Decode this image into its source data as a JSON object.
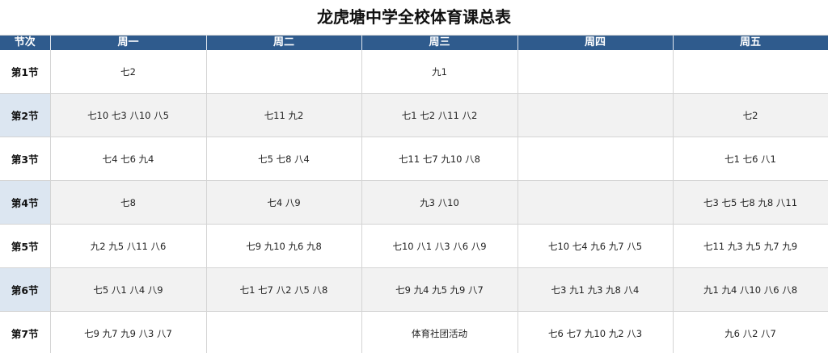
{
  "title": "龙虎塘中学全校体育课总表",
  "headers": [
    "节次",
    "周一",
    "周二",
    "周三",
    "周四",
    "周五"
  ],
  "rows": [
    {
      "period": "第1节",
      "cells": [
        "七2",
        "",
        "九1",
        "",
        ""
      ]
    },
    {
      "period": "第2节",
      "cells": [
        "七10 七3 八10 八5",
        "七11 九2",
        "七1 七2 八11 八2",
        "",
        "七2"
      ]
    },
    {
      "period": "第3节",
      "cells": [
        "七4 七6 九4",
        "七5 七8 八4",
        "七11 七7 九10 八8",
        "",
        "七1 七6 八1"
      ]
    },
    {
      "period": "第4节",
      "cells": [
        "七8",
        "七4 八9",
        "九3 八10",
        "",
        "七3 七5 七8 九8 八11"
      ]
    },
    {
      "period": "第5节",
      "cells": [
        "九2 九5 八11 八6",
        "七9 九10 九6 九8",
        "七10 八1 八3 八6 八9",
        "七10 七4 九6 九7 八5",
        "七11 九3 九5 九7 九9"
      ]
    },
    {
      "period": "第6节",
      "cells": [
        "七5 八1 八4 八9",
        "七1 七7 八2 八5 八8",
        "七9 九4 九5 九9 八7",
        "七3 九1 九3 九8 八4",
        "九1 九4 八10 八6 八8"
      ]
    },
    {
      "period": "第7节",
      "cells": [
        "七9 九7 九9 八3 八7",
        "",
        "体育社团活动",
        "七6 七7 九10 九2 八3",
        "九6 八2 八7"
      ]
    }
  ]
}
